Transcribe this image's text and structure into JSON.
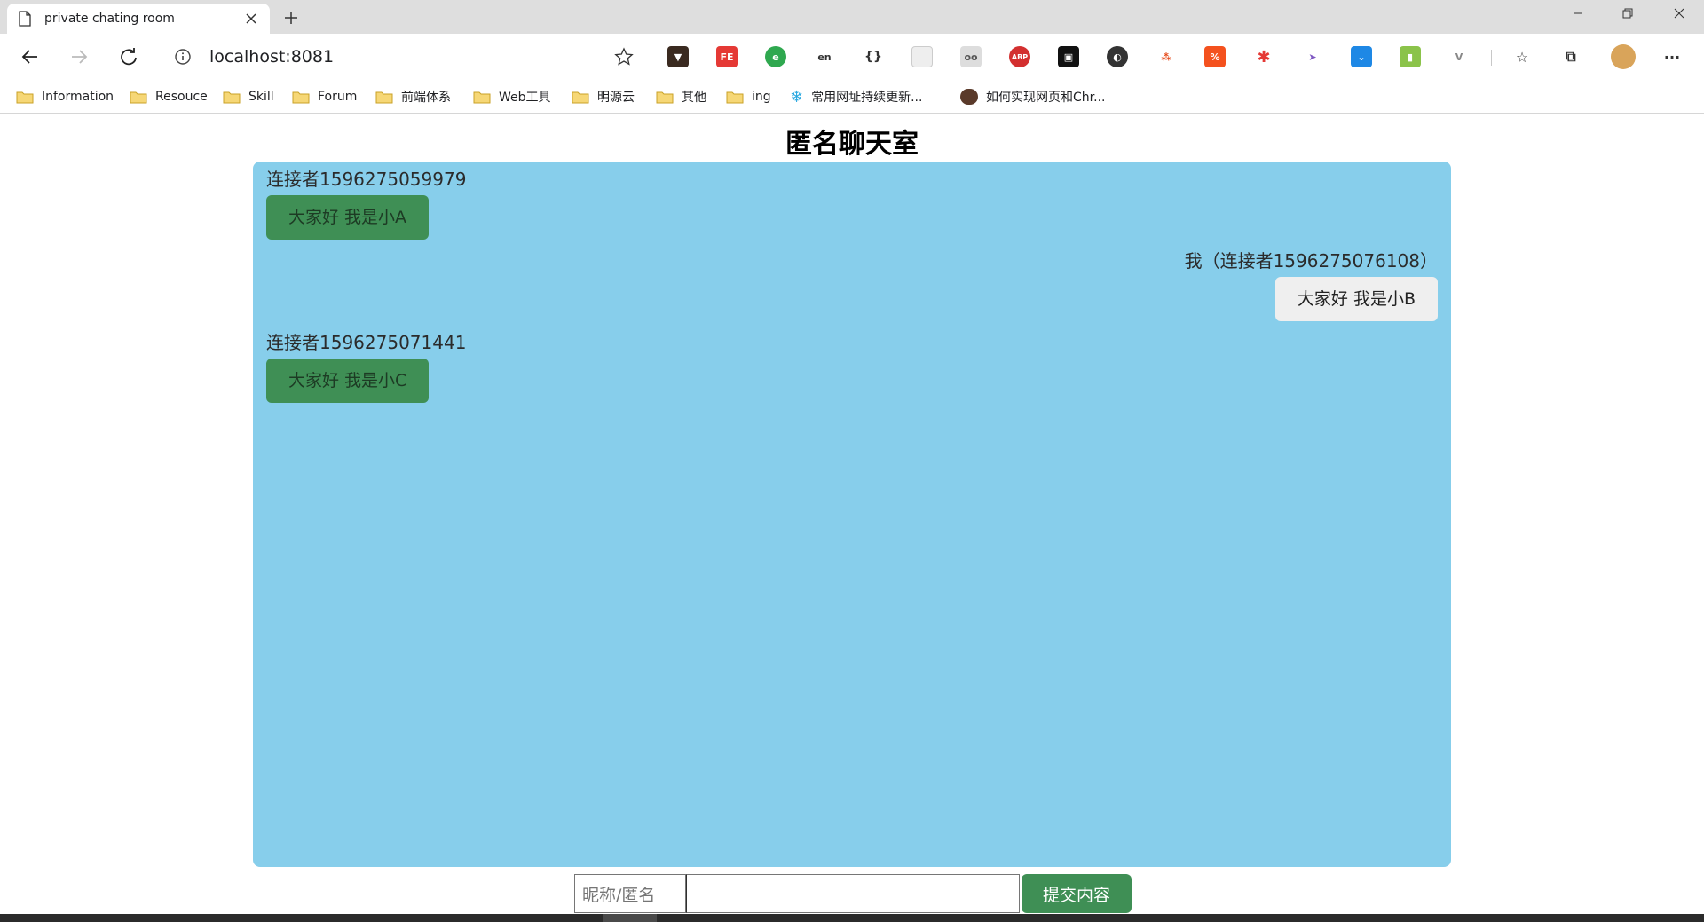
{
  "tab": {
    "title": "private chating room"
  },
  "toolbar": {
    "url": "localhost:8081"
  },
  "bookmarks": [
    {
      "label": "Information",
      "icon": "folder-icon"
    },
    {
      "label": "Resouce",
      "icon": "folder-icon"
    },
    {
      "label": "Skill",
      "icon": "folder-icon"
    },
    {
      "label": "Forum",
      "icon": "folder-icon"
    },
    {
      "label": "前端体系",
      "icon": "folder-icon"
    },
    {
      "label": "Web工具",
      "icon": "folder-icon"
    },
    {
      "label": "明源云",
      "icon": "folder-icon"
    },
    {
      "label": "其他",
      "icon": "folder-icon"
    },
    {
      "label": "ing",
      "icon": "folder-icon"
    },
    {
      "label": "常用网址持续更新...",
      "icon": "snowflake-icon"
    },
    {
      "label": "如何实现网页和Chr...",
      "icon": "avatar-icon"
    }
  ],
  "page": {
    "title": "匿名聊天室"
  },
  "messages": [
    {
      "sender": "连接者1596275059979",
      "text": "大家好 我是小A",
      "side": "left"
    },
    {
      "sender": "我（连接者1596275076108）",
      "text": "大家好 我是小B",
      "side": "right"
    },
    {
      "sender": "连接者1596275071441",
      "text": "大家好 我是小C",
      "side": "left"
    }
  ],
  "form": {
    "nickname_placeholder": "昵称/匿名",
    "content_value": "",
    "submit_label": "提交内容"
  },
  "colors": {
    "chat_background": "#87ceeb",
    "bubble_green": "#3f8f55",
    "bubble_self": "#efefef",
    "submit_button": "#3f8f55"
  }
}
